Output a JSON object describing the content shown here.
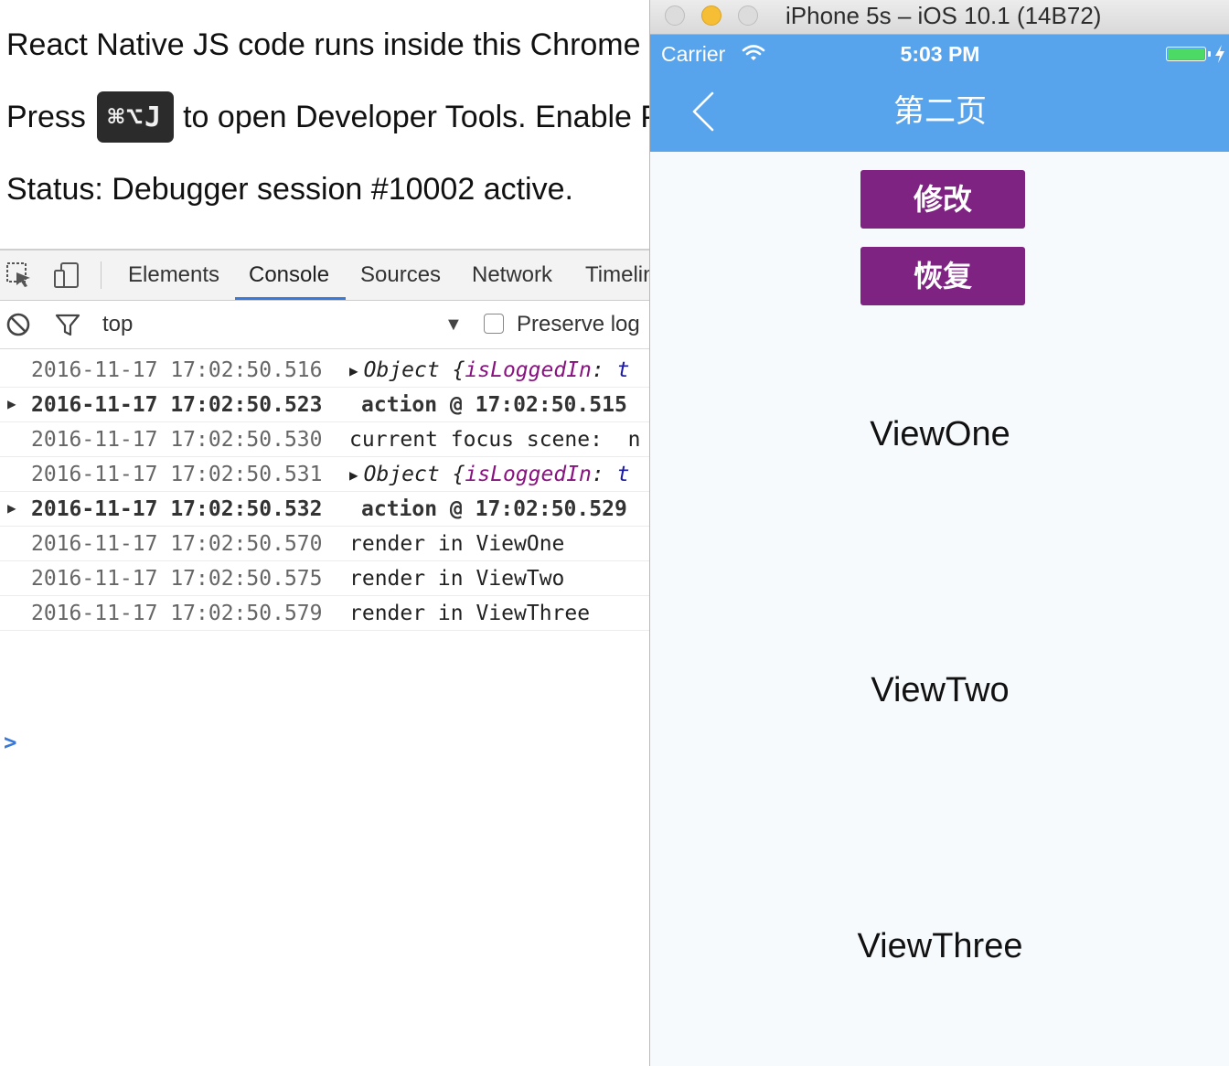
{
  "debugger": {
    "line1": "React Native JS code runs inside this Chrome tab.",
    "line2_prefix": "Press",
    "shortcut": "⌘⌥J",
    "line2_suffix": "to open Developer Tools. Enable Pause On Caught Exceptions for a better debugging experience.",
    "status": "Status: Debugger session #10002 active."
  },
  "devtools": {
    "tabs": [
      "Elements",
      "Console",
      "Sources",
      "Network",
      "Timeline"
    ],
    "active_tab": "Console",
    "context": "top",
    "preserve_log_label": "Preserve log",
    "preserve_log_checked": false,
    "prompt": ">",
    "rows": [
      {
        "ts": "2016-11-17 17:02:50.516",
        "kind": "object",
        "obj": "Object {",
        "key": "isLoggedIn",
        "colon": ":",
        "val": "t"
      },
      {
        "ts": "2016-11-17 17:02:50.523",
        "kind": "group",
        "msg": "action @ 17:02:50.515"
      },
      {
        "ts": "2016-11-17 17:02:50.530",
        "kind": "text",
        "msg": "current focus scene:  n"
      },
      {
        "ts": "2016-11-17 17:02:50.531",
        "kind": "object",
        "obj": "Object {",
        "key": "isLoggedIn",
        "colon": ":",
        "val": "t"
      },
      {
        "ts": "2016-11-17 17:02:50.532",
        "kind": "group",
        "msg": "action @ 17:02:50.529"
      },
      {
        "ts": "2016-11-17 17:02:50.570",
        "kind": "text",
        "msg": "render in ViewOne"
      },
      {
        "ts": "2016-11-17 17:02:50.575",
        "kind": "text",
        "msg": "render in ViewTwo"
      },
      {
        "ts": "2016-11-17 17:02:50.579",
        "kind": "text",
        "msg": "render in ViewThree"
      }
    ]
  },
  "simulator": {
    "window_title": "iPhone 5s – iOS 10.1 (14B72)",
    "carrier": "Carrier",
    "time": "5:03 PM",
    "battery_level": 1.0,
    "nav_title": "第二页",
    "buttons": [
      "修改",
      "恢复"
    ],
    "views": [
      "ViewOne",
      "ViewTwo",
      "ViewThree"
    ],
    "colors": {
      "nav_bg": "#57a4ec",
      "button_bg": "#7f2382",
      "content_bg": "#f6fafd",
      "battery": "#4cd964"
    }
  }
}
